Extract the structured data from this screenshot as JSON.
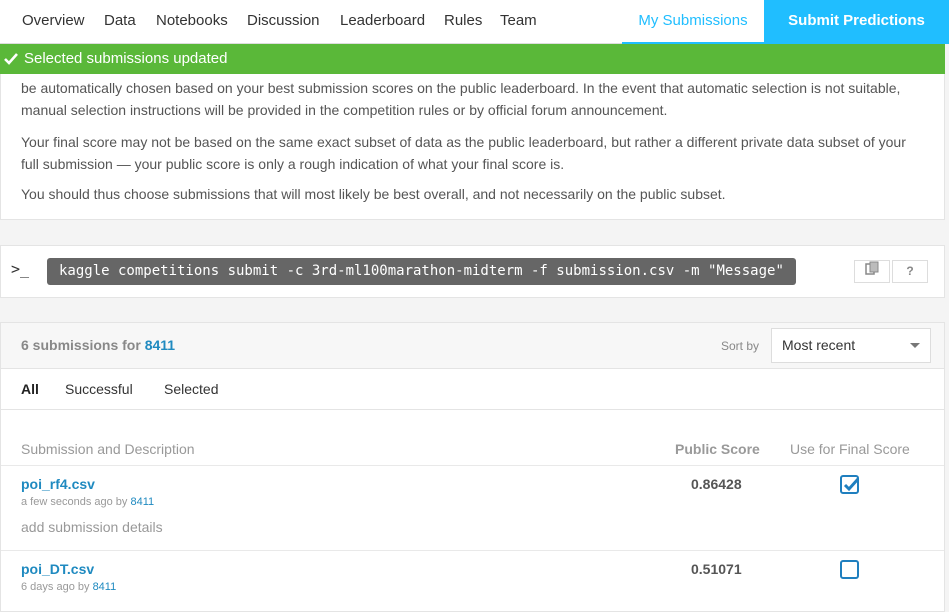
{
  "nav": {
    "tabs": [
      {
        "label": "Overview"
      },
      {
        "label": "Data"
      },
      {
        "label": "Notebooks"
      },
      {
        "label": "Discussion"
      },
      {
        "label": "Leaderboard"
      },
      {
        "label": "Rules"
      },
      {
        "label": "Team"
      },
      {
        "label": "My Submissions"
      }
    ],
    "submit_label": "Submit Predictions",
    "accent_color": "#20beff"
  },
  "notice": {
    "text": "Selected submissions updated",
    "icon": "check-icon",
    "color": "#5ab839"
  },
  "info": {
    "para1": "be automatically chosen based on your best submission scores on the public leaderboard. In the event that automatic selection is not suitable, manual selection instructions will be provided in the competition rules or by official forum announcement.",
    "para2": "Your final score may not be based on the same exact subset of data as the public leaderboard, but rather a different private data subset of your full submission — your public score is only a rough indication of what your final score is.",
    "para3": "You should thus choose submissions that will most likely be best overall, and not necessarily on the public subset."
  },
  "cli": {
    "prompt": ">_",
    "command": "kaggle competitions submit -c 3rd-ml100marathon-midterm -f submission.csv -m \"Message\"",
    "copy_icon": "copy-icon",
    "help_label": "?"
  },
  "submissions": {
    "count_prefix": "6 submissions for",
    "user": "8411",
    "sort_label": "Sort by",
    "sort_value": "Most recent",
    "filters": [
      "All",
      "Successful",
      "Selected"
    ],
    "columns": {
      "description": "Submission and Description",
      "score": "Public Score",
      "final": "Use for Final Score"
    },
    "rows": [
      {
        "name": "poi_rf4.csv",
        "time": "a few seconds ago by",
        "by": "8411",
        "details": "add submission details",
        "score": "0.86428",
        "selected": true
      },
      {
        "name": "poi_DT.csv",
        "time": "6 days ago by",
        "by": "8411",
        "details": "",
        "score": "0.51071",
        "selected": false
      }
    ]
  }
}
